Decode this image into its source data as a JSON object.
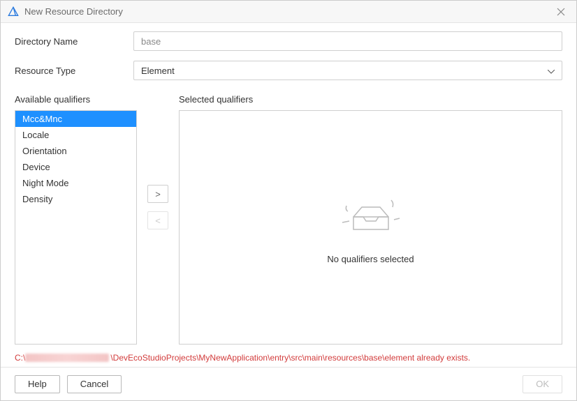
{
  "titlebar": {
    "title": "New Resource Directory"
  },
  "form": {
    "directory_name_label": "Directory Name",
    "directory_name_value": "base",
    "resource_type_label": "Resource Type",
    "resource_type_value": "Element"
  },
  "qualifiers": {
    "available_label": "Available qualifiers",
    "selected_label": "Selected qualifiers",
    "available_items": [
      "Mcc&Mnc",
      "Locale",
      "Orientation",
      "Device",
      "Night Mode",
      "Density"
    ],
    "selected_index": 0,
    "empty_message": "No qualifiers selected",
    "add_symbol": ">",
    "remove_symbol": "<"
  },
  "error": {
    "prefix": "C:\\",
    "suffix": "\\DevEcoStudioProjects\\MyNewApplication\\entry\\src\\main\\resources\\base\\element already exists."
  },
  "footer": {
    "help_label": "Help",
    "cancel_label": "Cancel",
    "ok_label": "OK"
  }
}
